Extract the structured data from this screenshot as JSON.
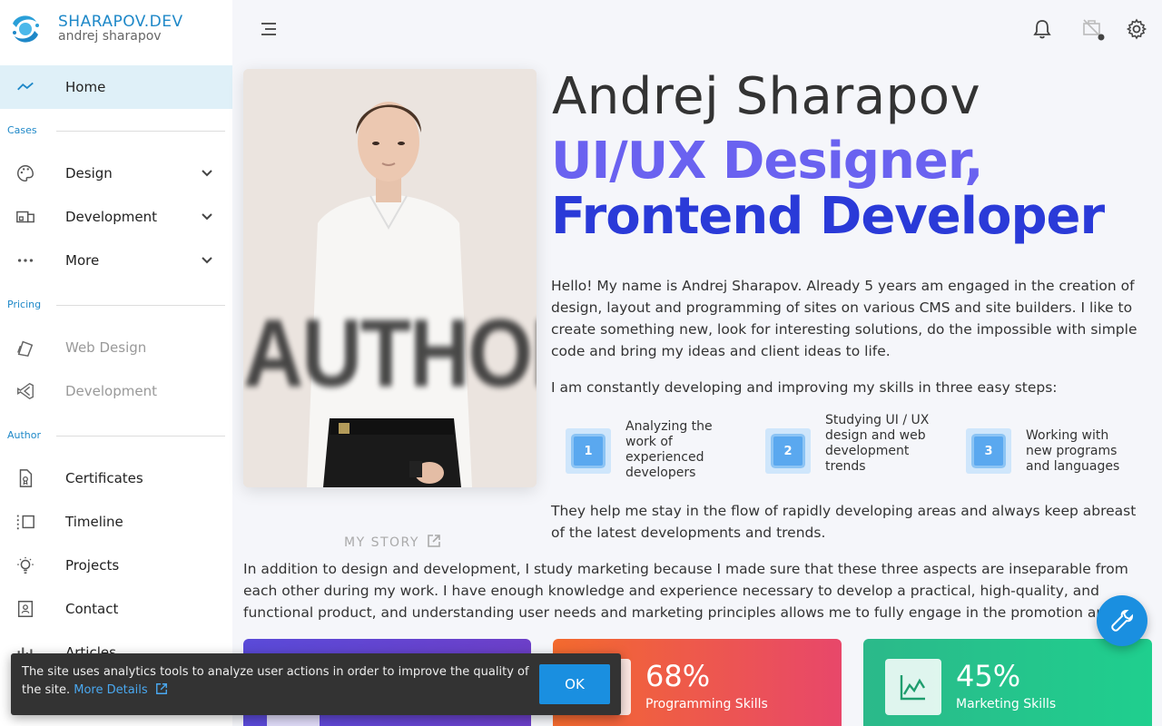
{
  "brand": {
    "name": "SHARAPOV.DEV",
    "subtitle": "andrej sharapov"
  },
  "sidebar": {
    "home": "Home",
    "sections": {
      "cases": "Cases",
      "pricing": "Pricing",
      "author": "Author"
    },
    "cases": [
      "Design",
      "Development",
      "More"
    ],
    "pricing": [
      "Web Design",
      "Development"
    ],
    "author": [
      "Certificates",
      "Timeline",
      "Projects",
      "Contact",
      "Articles"
    ]
  },
  "photo": {
    "overlay_text": "AUTHOR",
    "story_link": "MY STORY"
  },
  "hero": {
    "name": "Andrej Sharapov",
    "role_line1": "UI/UX Designer,",
    "role_line2": "Frontend Developer"
  },
  "content": {
    "intro": "Hello! My name is Andrej Sharapov. Already 5 years am engaged in the creation of design, layout and programming of sites on various CMS and site builders. I like to create something new, look for interesting solutions, do the impossible with simple code and bring my ideas and client ideas to life.",
    "steps_intro": "I am constantly developing and improving my skills in three easy steps:",
    "steps": [
      {
        "num": "1",
        "text": "Analyzing the work of experienced developers"
      },
      {
        "num": "2",
        "text": "Studying UI / UX design and web development trends"
      },
      {
        "num": "3",
        "text": "Working with new programs and languages"
      }
    ],
    "flow": "They help me stay in the flow of rapidly developing areas and always keep abreast of the latest developments and trends.",
    "marketing": "In addition to design and development, I study marketing because I made sure that these three aspects are inseparable from each other during my work. I have enough knowledge and experience necessary to develop a practical, high-quality, and functional product, and understanding user needs and marketing principles allows me to fully engage in the promotion and support of the developed product."
  },
  "stats": [
    {
      "value": "",
      "label": ""
    },
    {
      "value": "68%",
      "label": "Programming Skills"
    },
    {
      "value": "45%",
      "label": "Marketing Skills"
    }
  ],
  "cookie": {
    "text": "The site uses analytics tools to analyze user actions in order to improve the quality of the site.",
    "link": "More Details",
    "ok": "OK"
  },
  "colors": {
    "accent": "#1e88c8",
    "role1": "#6a62f0",
    "role2": "#2a3ad8",
    "fab": "#1a8fe0"
  }
}
